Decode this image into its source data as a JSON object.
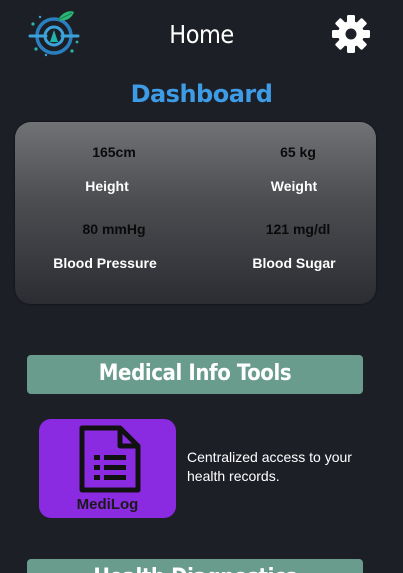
{
  "header": {
    "title": "Home",
    "logo_icon": "medical-globe-leaf-icon",
    "settings_icon": "gear-icon"
  },
  "dashboard": {
    "title": "Dashboard",
    "stats": [
      {
        "value": "165cm",
        "label": "Height"
      },
      {
        "value": "65 kg",
        "label": "Weight"
      },
      {
        "value": "80 mmHg",
        "label": "Blood Pressure"
      },
      {
        "value": "121 mg/dl",
        "label": "Blood Sugar"
      }
    ]
  },
  "sections": [
    {
      "title": "Medical Info Tools"
    },
    {
      "title": "Health Diagnostics"
    }
  ],
  "tools": [
    {
      "label": "MediLog",
      "icon": "document-list-icon",
      "description": "Centralized access to your health records."
    }
  ],
  "colors": {
    "background": "#1d1f27",
    "accent_blue": "#3e9be6",
    "band_green": "#6a9c8e",
    "tile_purple": "#8a2be2"
  }
}
